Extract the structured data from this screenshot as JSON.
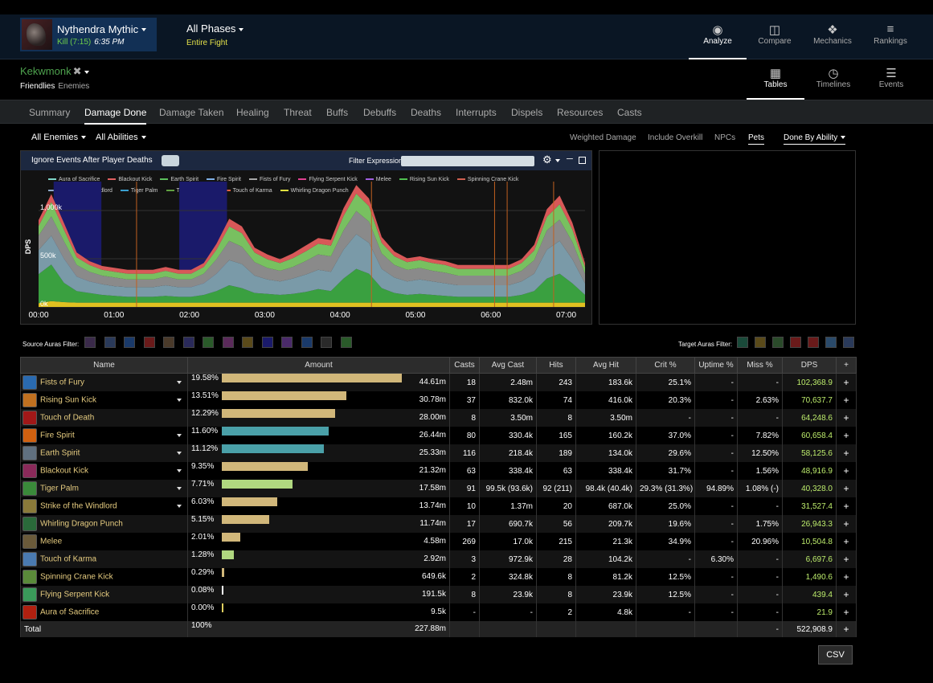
{
  "encounter": {
    "name": "Nythendra Mythic",
    "result": "Kill (7:15)",
    "time": "6:35 PM"
  },
  "phase": {
    "name": "All Phases",
    "sub": "Entire Fight"
  },
  "top_nav": [
    {
      "label": "Analyze",
      "icon": "eye-icon",
      "active": true
    },
    {
      "label": "Compare",
      "icon": "compare-icon"
    },
    {
      "label": "Mechanics",
      "icon": "puzzle-icon"
    },
    {
      "label": "Rankings",
      "icon": "rankings-icon"
    }
  ],
  "player": {
    "name": "Kekwmonk",
    "friendlies": "Friendlies",
    "enemies": "Enemies"
  },
  "view_nav": [
    {
      "label": "Tables",
      "icon": "grid-icon",
      "active": true
    },
    {
      "label": "Timelines",
      "icon": "clock-icon"
    },
    {
      "label": "Events",
      "icon": "list-icon"
    }
  ],
  "tabs": [
    "Summary",
    "Damage Done",
    "Damage Taken",
    "Healing",
    "Threat",
    "Buffs",
    "Debuffs",
    "Deaths",
    "Interrupts",
    "Dispels",
    "Resources",
    "Casts"
  ],
  "active_tab": "Damage Done",
  "filters": {
    "enemies": "All Enemies",
    "abilities": "All Abilities",
    "right": [
      "Weighted Damage",
      "Include Overkill",
      "NPCs",
      "Pets"
    ],
    "active_right": "Pets",
    "done_by": "Done By Ability"
  },
  "chart_toolbar": {
    "ignore_label": "Ignore Events After Player Deaths",
    "filter_label": "Filter Expression:"
  },
  "chart_data": {
    "type": "area",
    "ylabel": "DPS",
    "ylim": [
      0,
      1250000
    ],
    "yticks": [
      "0k",
      "500k",
      "1,000k"
    ],
    "xticks": [
      "00:00",
      "01:00",
      "02:00",
      "03:00",
      "04:00",
      "05:00",
      "06:00",
      "07:00"
    ],
    "xlim": [
      0,
      435
    ],
    "stacked": true,
    "legend": [
      {
        "name": "Aura of Sacrifice",
        "color": "#7fd6c8"
      },
      {
        "name": "Blackout Kick",
        "color": "#e06060"
      },
      {
        "name": "Earth Spirit",
        "color": "#5cc05c"
      },
      {
        "name": "Fire Spirit",
        "color": "#7fb0e6"
      },
      {
        "name": "Fists of Fury",
        "color": "#a8a8a8"
      },
      {
        "name": "Flying Serpent Kick",
        "color": "#e04090"
      },
      {
        "name": "Melee",
        "color": "#a060e0"
      },
      {
        "name": "Rising Sun Kick",
        "color": "#50c050"
      },
      {
        "name": "Spinning Crane Kick",
        "color": "#d06050"
      },
      {
        "name": "Strike of the Windlord",
        "color": "#8fa8c8"
      },
      {
        "name": "Tiger Palm",
        "color": "#3aa0d0"
      },
      {
        "name": "Touch of Death",
        "color": "#60a040"
      },
      {
        "name": "Touch of Karma",
        "color": "#e06040"
      },
      {
        "name": "Whirling Dragon Punch",
        "color": "#e0e040"
      }
    ],
    "series_stack": [
      {
        "name": "Tiger Palm",
        "color": "#e0c020",
        "values": [
          40,
          60,
          50,
          45,
          45,
          45,
          45,
          45,
          45,
          45,
          45,
          45,
          45,
          45,
          45,
          45,
          45,
          45,
          45,
          45,
          45,
          45,
          45,
          45,
          45,
          45,
          45,
          45,
          45,
          45,
          45,
          45,
          45,
          45,
          45,
          45,
          45,
          45,
          45,
          45,
          45,
          45,
          45,
          45
        ]
      },
      {
        "name": "Earth Spirit",
        "color": "#3aa040",
        "values": [
          300,
          380,
          200,
          120,
          100,
          80,
          70,
          60,
          60,
          60,
          70,
          60,
          60,
          80,
          120,
          180,
          150,
          100,
          90,
          80,
          90,
          110,
          140,
          120,
          250,
          350,
          300,
          150,
          100,
          80,
          90,
          80,
          70,
          60,
          60,
          60,
          60,
          60,
          80,
          120,
          250,
          300,
          200,
          80
        ]
      },
      {
        "name": "Fire Spirit",
        "color": "#7a9aa8",
        "values": [
          250,
          300,
          250,
          150,
          120,
          110,
          100,
          100,
          100,
          100,
          110,
          100,
          100,
          120,
          180,
          260,
          250,
          180,
          150,
          140,
          160,
          180,
          200,
          200,
          300,
          360,
          320,
          200,
          160,
          140,
          150,
          140,
          130,
          120,
          120,
          120,
          120,
          120,
          140,
          180,
          300,
          340,
          250,
          120
        ]
      },
      {
        "name": "Fists of Fury",
        "color": "#8a8a8a",
        "values": [
          150,
          200,
          180,
          120,
          100,
          90,
          90,
          80,
          80,
          80,
          90,
          80,
          80,
          100,
          150,
          200,
          180,
          140,
          120,
          110,
          120,
          140,
          160,
          160,
          200,
          240,
          220,
          160,
          130,
          120,
          120,
          110,
          110,
          100,
          100,
          100,
          100,
          100,
          110,
          140,
          200,
          220,
          180,
          100
        ]
      },
      {
        "name": "Rising Sun Kick",
        "color": "#78c060",
        "values": [
          100,
          150,
          120,
          80,
          70,
          60,
          60,
          60,
          60,
          60,
          60,
          60,
          60,
          70,
          100,
          150,
          140,
          100,
          90,
          80,
          90,
          100,
          110,
          110,
          150,
          180,
          160,
          110,
          90,
          80,
          80,
          80,
          80,
          70,
          70,
          70,
          70,
          70,
          80,
          100,
          140,
          160,
          130,
          70
        ]
      },
      {
        "name": "Blackout Kick",
        "color": "#d85858",
        "values": [
          60,
          80,
          70,
          50,
          40,
          40,
          40,
          40,
          40,
          40,
          40,
          40,
          40,
          40,
          60,
          80,
          70,
          50,
          50,
          40,
          50,
          60,
          60,
          60,
          80,
          90,
          80,
          60,
          50,
          40,
          40,
          40,
          40,
          40,
          40,
          40,
          40,
          40,
          40,
          60,
          80,
          90,
          70,
          40
        ]
      }
    ],
    "phases_shaded": [
      [
        12,
        50
      ],
      [
        112,
        150
      ]
    ],
    "markers": [
      78,
      265,
      363,
      373,
      410
    ]
  },
  "auras": {
    "source_label": "Source Auras Filter:",
    "target_label": "Target Auras Filter:",
    "source_colors": [
      "#3a2a4a",
      "#2a3a5a",
      "#1a3a6a",
      "#6a1a1a",
      "#4a3a2a",
      "#2a2a5a",
      "#2a5a2a",
      "#5a2a5a",
      "#5a4a1a",
      "#1a1a6a",
      "#4a2a6a",
      "#1a3a6a",
      "#2a2a2a",
      "#2a5a2a"
    ],
    "target_colors": [
      "#1a4a3a",
      "#5a4a1a",
      "#2a4a2a",
      "#6a1a1a",
      "#6a1a1a",
      "#2a4a6a",
      "#2a3a5a"
    ]
  },
  "table": {
    "headers": [
      "Name",
      "Amount",
      "Casts",
      "Avg Cast",
      "Hits",
      "Avg Hit",
      "Crit %",
      "Uptime %",
      "Miss %",
      "DPS",
      "+"
    ],
    "rows": [
      {
        "name": "Fists of Fury",
        "icon_color": "#2a6ab0",
        "dropdown": true,
        "pct": "19.58%",
        "share": 19.58,
        "bar_color": "#d1b77a",
        "amount": "44.61m",
        "casts": "18",
        "avg_cast": "2.48m",
        "hits": "243",
        "avg_hit": "183.6k",
        "crit": "25.1%",
        "uptime": "-",
        "miss": "-",
        "dps": "102,368.9"
      },
      {
        "name": "Rising Sun Kick",
        "icon_color": "#c07020",
        "dropdown": true,
        "pct": "13.51%",
        "share": 13.51,
        "bar_color": "#d1b77a",
        "amount": "30.78m",
        "casts": "37",
        "avg_cast": "832.0k",
        "hits": "74",
        "avg_hit": "416.0k",
        "crit": "20.3%",
        "uptime": "-",
        "miss": "2.63%",
        "dps": "70,637.7"
      },
      {
        "name": "Touch of Death",
        "icon_color": "#a01818",
        "dropdown": false,
        "pct": "12.29%",
        "share": 12.29,
        "bar_color": "#d1b77a",
        "amount": "28.00m",
        "casts": "8",
        "avg_cast": "3.50m",
        "hits": "8",
        "avg_hit": "3.50m",
        "crit": "-",
        "uptime": "-",
        "miss": "-",
        "dps": "64,248.6"
      },
      {
        "name": "Fire Spirit",
        "icon_color": "#d06010",
        "dropdown": true,
        "pct": "11.60%",
        "share": 11.6,
        "bar_color": "#4aa0a8",
        "amount": "26.44m",
        "casts": "80",
        "avg_cast": "330.4k",
        "hits": "165",
        "avg_hit": "160.2k",
        "crit": "37.0%",
        "uptime": "-",
        "miss": "7.82%",
        "dps": "60,658.4"
      },
      {
        "name": "Earth Spirit",
        "icon_color": "#607080",
        "dropdown": true,
        "pct": "11.12%",
        "share": 11.12,
        "bar_color": "#4aa0a8",
        "amount": "25.33m",
        "casts": "116",
        "avg_cast": "218.4k",
        "hits": "189",
        "avg_hit": "134.0k",
        "crit": "29.6%",
        "uptime": "-",
        "miss": "12.50%",
        "dps": "58,125.6"
      },
      {
        "name": "Blackout Kick",
        "icon_color": "#8a2a5a",
        "dropdown": true,
        "pct": "9.35%",
        "share": 9.35,
        "bar_color": "#d1b77a",
        "amount": "21.32m",
        "casts": "63",
        "avg_cast": "338.4k",
        "hits": "63",
        "avg_hit": "338.4k",
        "crit": "31.7%",
        "uptime": "-",
        "miss": "1.56%",
        "dps": "48,916.9"
      },
      {
        "name": "Tiger Palm",
        "icon_color": "#3a8a3a",
        "dropdown": true,
        "pct": "7.71%",
        "share": 7.71,
        "bar_color": "#b0d880",
        "amount": "17.58m",
        "casts": "91",
        "avg_cast": "99.5k (93.6k)",
        "hits": "92 (211)",
        "avg_hit": "98.4k (40.4k)",
        "crit": "29.3% (31.3%)",
        "uptime": "94.89%",
        "miss": "1.08% (-)",
        "dps": "40,328.0"
      },
      {
        "name": "Strike of the Windlord",
        "icon_color": "#8a7a3a",
        "dropdown": true,
        "pct": "6.03%",
        "share": 6.03,
        "bar_color": "#d1b77a",
        "amount": "13.74m",
        "casts": "10",
        "avg_cast": "1.37m",
        "hits": "20",
        "avg_hit": "687.0k",
        "crit": "25.0%",
        "uptime": "-",
        "miss": "-",
        "dps": "31,527.4"
      },
      {
        "name": "Whirling Dragon Punch",
        "icon_color": "#2a6a3a",
        "dropdown": false,
        "pct": "5.15%",
        "share": 5.15,
        "bar_color": "#d1b77a",
        "amount": "11.74m",
        "casts": "17",
        "avg_cast": "690.7k",
        "hits": "56",
        "avg_hit": "209.7k",
        "crit": "19.6%",
        "uptime": "-",
        "miss": "1.75%",
        "dps": "26,943.3"
      },
      {
        "name": "Melee",
        "icon_color": "#6a5a3a",
        "dropdown": false,
        "pct": "2.01%",
        "share": 2.01,
        "bar_color": "#d1b77a",
        "amount": "4.58m",
        "casts": "269",
        "avg_cast": "17.0k",
        "hits": "215",
        "avg_hit": "21.3k",
        "crit": "34.9%",
        "uptime": "-",
        "miss": "20.96%",
        "dps": "10,504.8"
      },
      {
        "name": "Touch of Karma",
        "icon_color": "#4a7ab0",
        "dropdown": false,
        "pct": "1.28%",
        "share": 1.28,
        "bar_color": "#b0d880",
        "amount": "2.92m",
        "casts": "3",
        "avg_cast": "972.9k",
        "hits": "28",
        "avg_hit": "104.2k",
        "crit": "-",
        "uptime": "6.30%",
        "miss": "-",
        "dps": "6,697.6"
      },
      {
        "name": "Spinning Crane Kick",
        "icon_color": "#5a8a3a",
        "dropdown": false,
        "pct": "0.29%",
        "share": 0.29,
        "bar_color": "#d1b77a",
        "amount": "649.6k",
        "casts": "2",
        "avg_cast": "324.8k",
        "hits": "8",
        "avg_hit": "81.2k",
        "crit": "12.5%",
        "uptime": "-",
        "miss": "-",
        "dps": "1,490.6"
      },
      {
        "name": "Flying Serpent Kick",
        "icon_color": "#3a9a5a",
        "dropdown": false,
        "pct": "0.08%",
        "share": 0.08,
        "bar_color": "#ffffff",
        "amount": "191.5k",
        "casts": "8",
        "avg_cast": "23.9k",
        "hits": "8",
        "avg_hit": "23.9k",
        "crit": "12.5%",
        "uptime": "-",
        "miss": "-",
        "dps": "439.4"
      },
      {
        "name": "Aura of Sacrifice",
        "icon_color": "#b02010",
        "dropdown": false,
        "pct": "0.00%",
        "share": 0.0,
        "bar_color": "#e0d060",
        "amount": "9.5k",
        "casts": "-",
        "avg_cast": "-",
        "hits": "2",
        "avg_hit": "4.8k",
        "crit": "-",
        "uptime": "-",
        "miss": "-",
        "dps": "21.9"
      }
    ],
    "total": {
      "label": "Total",
      "pct": "100%",
      "amount": "227.88m",
      "miss": "-",
      "dps": "522,908.9"
    }
  },
  "csv_label": "CSV"
}
